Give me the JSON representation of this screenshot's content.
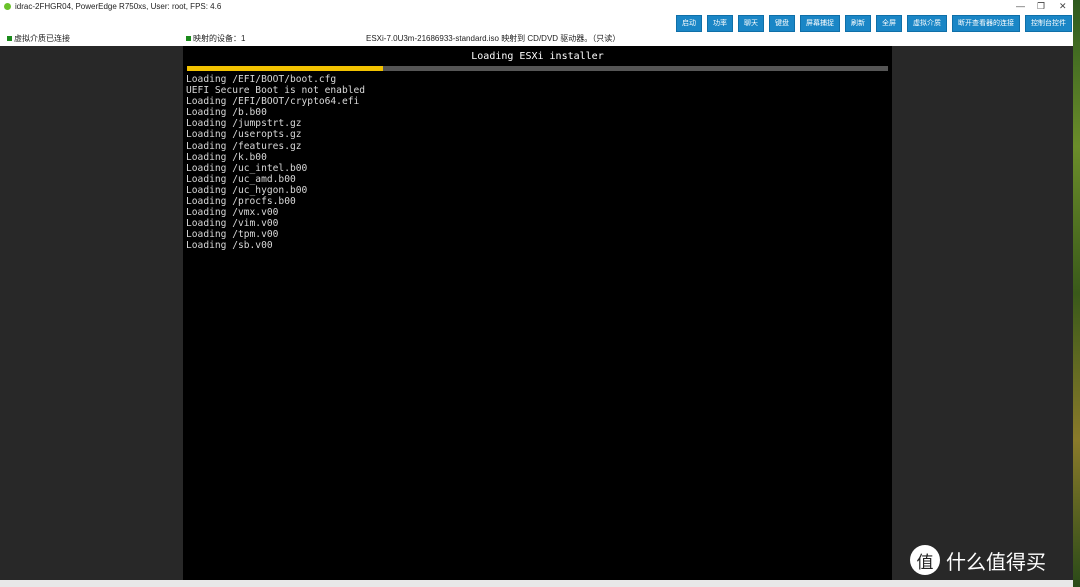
{
  "window": {
    "title": "idrac-2FHGR04, PowerEdge R750xs, User: root, FPS: 4.6"
  },
  "toolbar": [
    "启动",
    "功率",
    "聊天",
    "键盘",
    "屏幕捕捉",
    "刷新",
    "全屏",
    "虚拟介质",
    "断开查看器的连接",
    "控制台控件"
  ],
  "status": {
    "vmedia": "虚拟介质已连接",
    "mapped": "映射的设备：1",
    "iso": "ESXi-7.0U3m-21686933-standard.iso 映射到 CD/DVD 驱动器。（只读）"
  },
  "colors": {
    "button": "#1a86c6",
    "status_ok": "#1b8a1b",
    "progress": "#f2c200"
  },
  "console": {
    "title": "Loading ESXi installer",
    "progress_percent": 28,
    "lines": [
      "Loading /EFI/BOOT/boot.cfg",
      "UEFI Secure Boot is not enabled",
      "Loading /EFI/BOOT/crypto64.efi",
      "Loading /b.b00",
      "Loading /jumpstrt.gz",
      "Loading /useropts.gz",
      "Loading /features.gz",
      "Loading /k.b00",
      "Loading /uc_intel.b00",
      "Loading /uc_amd.b00",
      "Loading /uc_hygon.b00",
      "Loading /procfs.b00",
      "Loading /vmx.v00",
      "Loading /vim.v00",
      "Loading /tpm.v00",
      "Loading /sb.v00"
    ]
  },
  "watermark": {
    "icon": "值",
    "text": "什么值得买"
  }
}
